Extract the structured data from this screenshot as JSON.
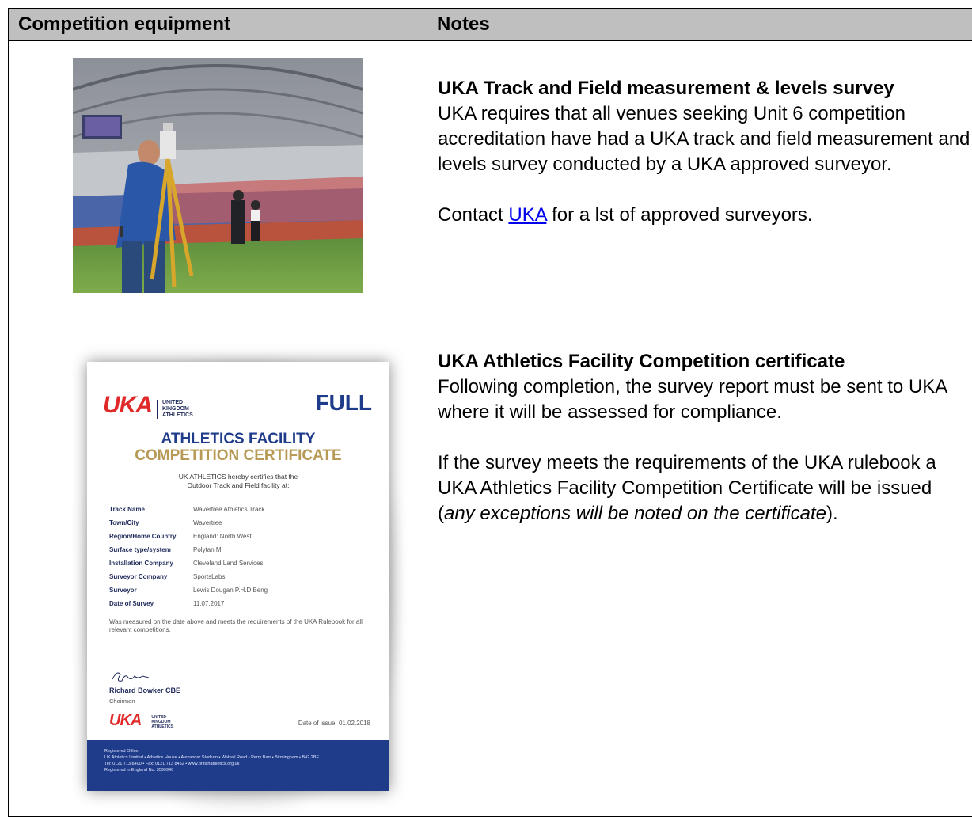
{
  "table": {
    "headers": {
      "equipment": "Competition equipment",
      "notes": "Notes"
    }
  },
  "row1": {
    "image_alt": "surveyor-with-theodolite-in-stadium",
    "title": "UKA Track and Field measurement & levels survey",
    "body": "UKA requires that all venues seeking Unit 6 competition accreditation have had a UKA track and field measurement and levels survey conducted by a UKA approved surveyor.",
    "contact_before": "Contact ",
    "contact_link": "UKA",
    "contact_after": " for a lst of approved surveyors."
  },
  "row2": {
    "title": "UKA Athletics Facility Competition certificate",
    "body1": "Following completion, the survey report must be sent to UKA where it will be assessed for compliance.",
    "body2_start": "If the survey meets the requirements of the UKA rulebook a UKA Athletics Facility Competition Certificate will be issued (",
    "body2_italic": "any exceptions will be noted on the certificate",
    "body2_end": ")."
  },
  "certificate": {
    "logo": "UKA",
    "logo_small": [
      "UNITED",
      "KINGDOM",
      "ATHLETICS"
    ],
    "badge": "FULL",
    "title1": "ATHLETICS FACILITY",
    "title2": "COMPETITION CERTIFICATE",
    "intro1": "UK ATHLETICS hereby certifies that the",
    "intro2": "Outdoor Track and Field facility at:",
    "fields": [
      {
        "label": "Track Name",
        "value": "Wavertree Athletics Track"
      },
      {
        "label": "Town/City",
        "value": "Wavertree"
      },
      {
        "label": "Region/Home Country",
        "value": "England: North West"
      },
      {
        "label": "Surface type/system",
        "value": "Polytan M"
      },
      {
        "label": "Installation Company",
        "value": "Cleveland Land Services"
      },
      {
        "label": "Surveyor Company",
        "value": "SportsLabs"
      },
      {
        "label": "Surveyor",
        "value": "Lewis Dougan P.H.D Beng"
      },
      {
        "label": "Date of Survey",
        "value": "11.07.2017"
      }
    ],
    "meets": "Was measured on the date above and meets the requirements of the UKA Rulebook for all relevant competitions.",
    "signer": "Richard Bowker CBE",
    "role": "Chairman",
    "date_of_issue": "Date of issue: 01.02.2018",
    "footer1": "Registered Office:",
    "footer2": "UK Athletics Limited • Athletics House • Alexander Stadium • Walsall Road • Perry Barr • Birmingham • B42 2BE",
    "footer3": "Tel: 0121 713 8400 • Fax: 0121 713 8452 • www.britishathletics.org.uk",
    "footer4": "Registered in England No. 3599940"
  }
}
